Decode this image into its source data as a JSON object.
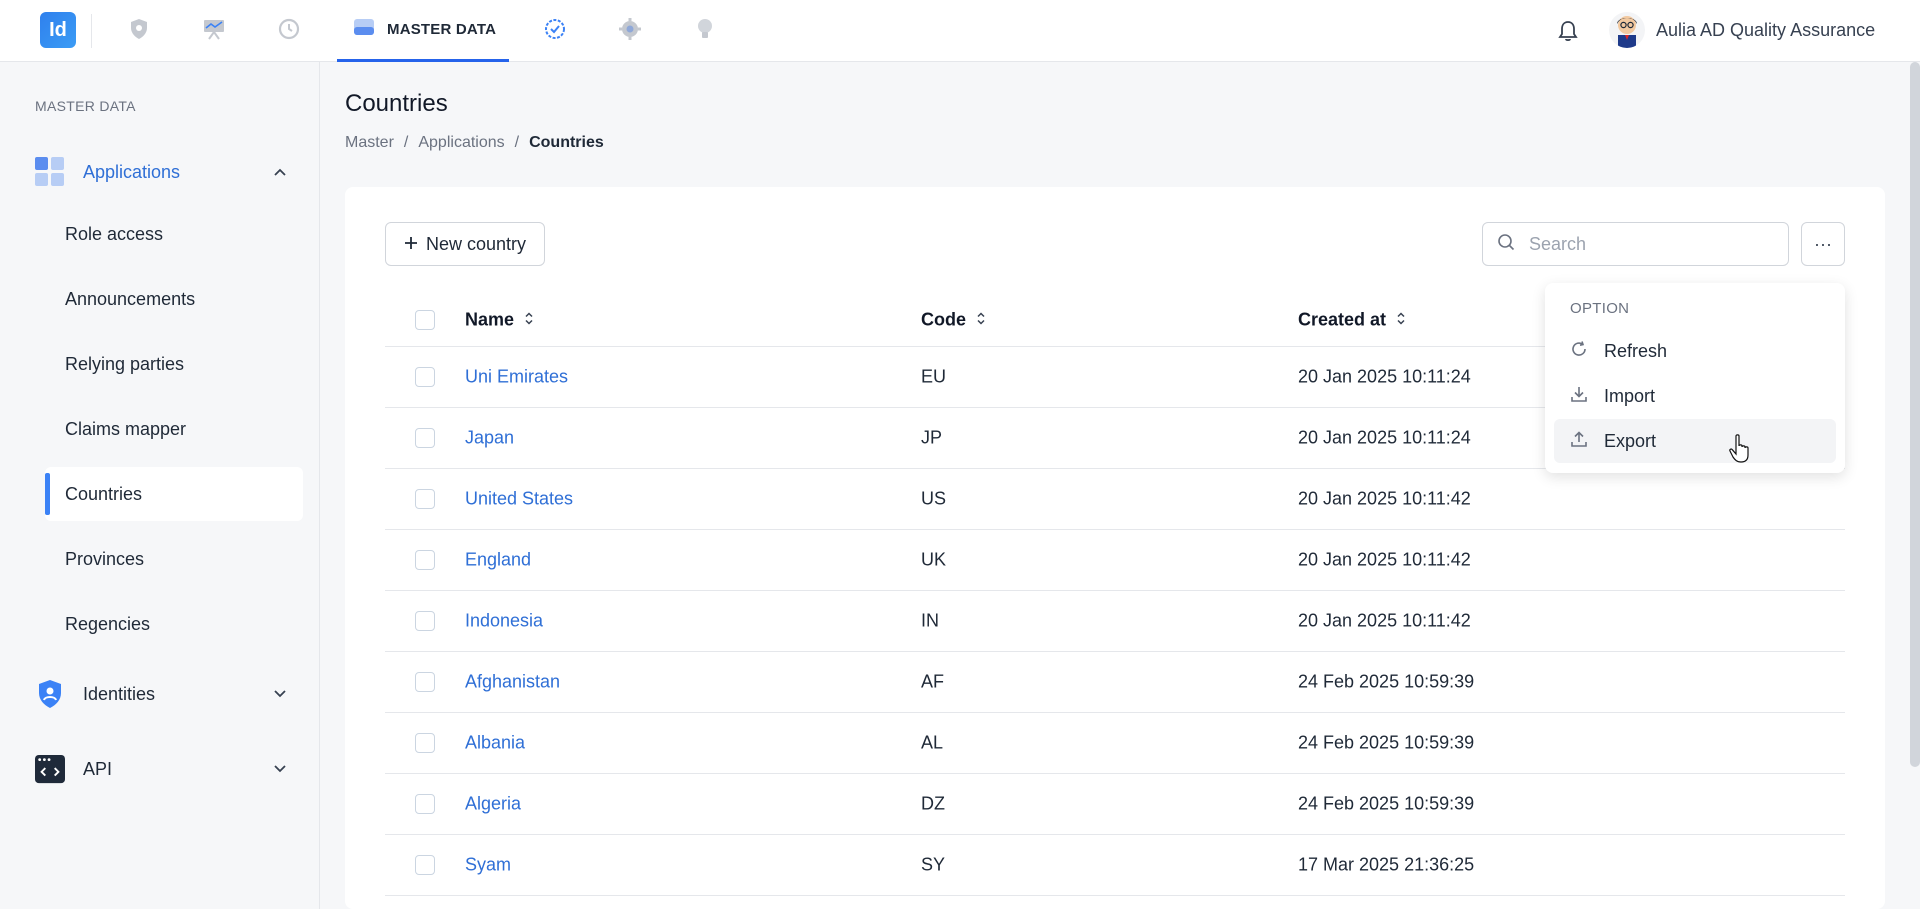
{
  "topbar": {
    "logo_text": "Id",
    "active_tab_label": "MASTER DATA",
    "user_name": "Aulia AD Quality Assurance",
    "nav_icons": [
      "shield-icon",
      "presentation-icon",
      "history-clock-icon",
      "database-icon",
      "check-badge-icon",
      "gear-icon",
      "lightbulb-icon"
    ]
  },
  "sidebar": {
    "section_title": "MASTER DATA",
    "groups": [
      {
        "label": "Applications",
        "icon": "grid-apps-icon",
        "expanded": true
      },
      {
        "label": "Identities",
        "icon": "shield-user-icon",
        "expanded": false
      },
      {
        "label": "API",
        "icon": "code-window-icon",
        "expanded": false
      }
    ],
    "items": [
      {
        "label": "Role access"
      },
      {
        "label": "Announcements"
      },
      {
        "label": "Relying parties"
      },
      {
        "label": "Claims mapper"
      },
      {
        "label": "Countries",
        "active": true
      },
      {
        "label": "Provinces"
      },
      {
        "label": "Regencies"
      }
    ]
  },
  "page": {
    "title": "Countries",
    "breadcrumb": [
      "Master",
      "Applications",
      "Countries"
    ],
    "separator": "/"
  },
  "toolbar": {
    "new_label": "New country",
    "search_placeholder": "Search",
    "more_label": "···"
  },
  "table": {
    "columns": [
      "Name",
      "Code",
      "Created at"
    ],
    "rows": [
      {
        "name": "Uni Emirates",
        "code": "EU",
        "created": "20 Jan 2025 10:11:24"
      },
      {
        "name": "Japan",
        "code": "JP",
        "created": "20 Jan 2025 10:11:24"
      },
      {
        "name": "United States",
        "code": "US",
        "created": "20 Jan 2025 10:11:42"
      },
      {
        "name": "England",
        "code": "UK",
        "created": "20 Jan 2025 10:11:42"
      },
      {
        "name": "Indonesia",
        "code": "IN",
        "created": "20 Jan 2025 10:11:42"
      },
      {
        "name": "Afghanistan",
        "code": "AF",
        "created": "24 Feb 2025 10:59:39"
      },
      {
        "name": "Albania",
        "code": "AL",
        "created": "24 Feb 2025 10:59:39"
      },
      {
        "name": "Algeria",
        "code": "DZ",
        "created": "24 Feb 2025 10:59:39"
      },
      {
        "name": "Syam",
        "code": "SY",
        "created": "17 Mar 2025 21:36:25"
      }
    ]
  },
  "dropdown": {
    "title": "OPTION",
    "items": [
      {
        "label": "Refresh",
        "icon": "refresh-icon"
      },
      {
        "label": "Import",
        "icon": "download-icon"
      },
      {
        "label": "Export",
        "icon": "upload-icon",
        "hovered": true
      }
    ]
  },
  "colors": {
    "accent": "#2563eb",
    "link": "#2f6fd6",
    "active_indicator": "#3b82f6"
  }
}
